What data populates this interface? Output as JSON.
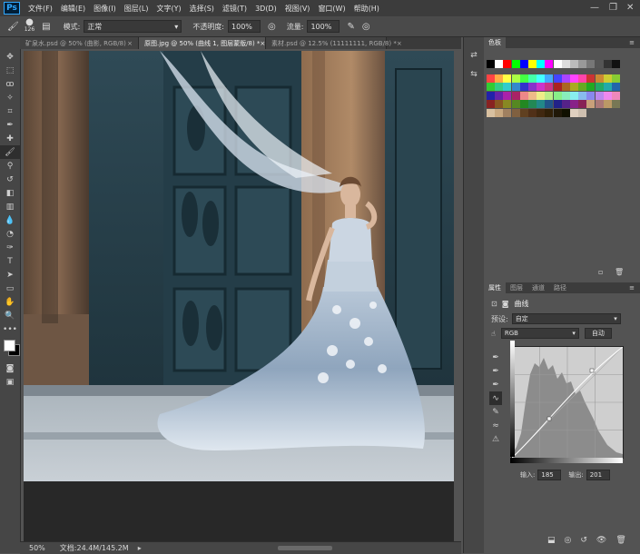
{
  "app": {
    "logo": "Ps",
    "menu": [
      "文件(F)",
      "编辑(E)",
      "图像(I)",
      "图层(L)",
      "文字(Y)",
      "选择(S)",
      "滤镜(T)",
      "3D(D)",
      "视图(V)",
      "窗口(W)",
      "帮助(H)"
    ],
    "window_controls": [
      "—",
      "❐",
      "✕"
    ]
  },
  "options_bar": {
    "brush_size": "126",
    "mode_label": "模式:",
    "mode_value": "正常",
    "opacity_label": "不透明度:",
    "opacity_value": "100%",
    "flow_label": "流量:",
    "flow_value": "100%"
  },
  "tabs": [
    {
      "label": "矿泉水.psd @ 50% (曲影, RGB/8)",
      "close": "×",
      "active": false
    },
    {
      "label": "原图.jpg @ 50% (曲线 1, 图层蒙版/8) *",
      "close": "×",
      "active": true
    },
    {
      "label": "素材.psd @ 12.5% (11111111, RGB/8) *",
      "close": "×",
      "active": false
    }
  ],
  "status": {
    "zoom": "50%",
    "doc_size": "文档:24.4M/145.2M"
  },
  "swatches_panel": {
    "title": "色板"
  },
  "properties_panel": {
    "tabs": [
      "属性",
      "图层",
      "通道",
      "路径"
    ],
    "adjust_name": "曲线",
    "preset_label": "预设:",
    "preset_value": "自定",
    "channel_value": "RGB",
    "auto_label": "自动",
    "input_label": "输入:",
    "input_value": "185",
    "output_label": "输出:",
    "output_value": "201"
  },
  "colors": {
    "accent": "#31a8ff",
    "panel_bg": "#535353",
    "chrome_bg": "#3c3c3c"
  }
}
